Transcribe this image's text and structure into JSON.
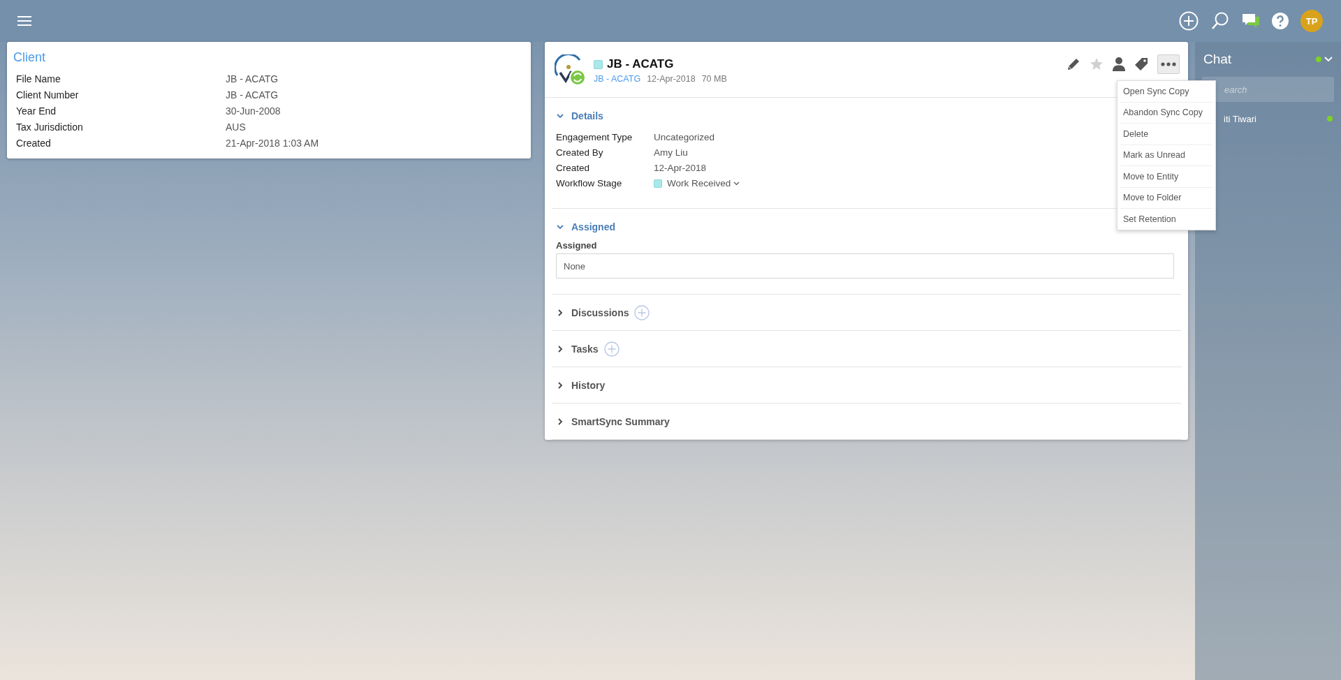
{
  "top_bar": {
    "avatar_initials": "TP"
  },
  "client_card": {
    "title": "Client",
    "fields": [
      {
        "label": "File Name",
        "value": "JB - ACATG"
      },
      {
        "label": "Client Number",
        "value": "JB - ACATG"
      },
      {
        "label": "Year End",
        "value": "30-Jun-2008"
      },
      {
        "label": "Tax Jurisdiction",
        "value": "AUS"
      },
      {
        "label": "Created",
        "value": "21-Apr-2018 1:03 AM"
      }
    ]
  },
  "document": {
    "title": "JB - ACATG",
    "client_link": "JB - ACATG",
    "date": "12-Apr-2018",
    "size": "70 MB",
    "starred": false,
    "more_menu": {
      "open": true,
      "items": [
        "Open Sync Copy",
        "Abandon Sync Copy",
        "Delete",
        "Mark as Unread",
        "Move to Entity",
        "Move to Folder",
        "Set Retention"
      ]
    },
    "sections": [
      {
        "title": "Details",
        "expanded": true,
        "kind": "fields",
        "fields": [
          {
            "label": "Engagement Type",
            "value": "Uncategorized",
            "kind": "text"
          },
          {
            "label": "Created By",
            "value": "Amy Liu",
            "kind": "text"
          },
          {
            "label": "Created",
            "value": "12-Apr-2018",
            "kind": "text"
          },
          {
            "label": "Workflow Stage",
            "value": "Work Received",
            "kind": "stage"
          }
        ]
      },
      {
        "title": "Assigned",
        "expanded": true,
        "kind": "assigned",
        "label": "Assigned",
        "value": "None"
      },
      {
        "title": "Discussions",
        "expanded": false,
        "addable": true
      },
      {
        "title": "Tasks",
        "expanded": false,
        "addable": true
      },
      {
        "title": "History",
        "expanded": false,
        "addable": false
      },
      {
        "title": "SmartSync Summary",
        "expanded": false,
        "addable": false
      }
    ]
  },
  "chat": {
    "title": "Chat",
    "online": true,
    "search_placeholder": "earch",
    "contacts": [
      {
        "name": "iti Tiwari",
        "online": true
      }
    ]
  }
}
